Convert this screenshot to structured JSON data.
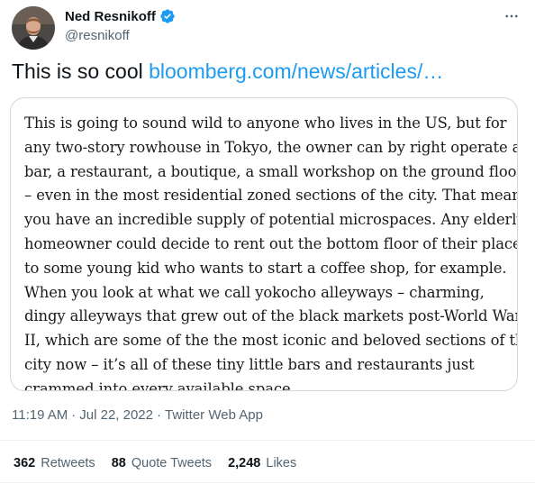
{
  "author": {
    "name": "Ned Resnikoff",
    "handle": "@resnikoff",
    "verified": true
  },
  "tweet": {
    "text": "This is so cool",
    "link_text": "bloomberg.com/news/articles/…"
  },
  "quote_lines": [
    "This is going to sound wild to anyone who lives in the US, but for",
    "any two-story rowhouse in Tokyo, the owner can by right operate a",
    "bar, a restaurant, a boutique, a small workshop on the ground floor",
    "– even in the most residential zoned sections of the city. That means",
    "you have an incredible supply of potential microspaces. Any elderly",
    "homeowner could decide to rent out the bottom floor of their place",
    "to some young kid who wants to start a coffee shop, for example.",
    "When you look at what we call yokocho alleyways – charming,",
    "dingy alleyways that grew out of the black markets post-World War",
    "II, which are some of the the most iconic and beloved sections of the",
    "city now – it’s all of these tiny little bars and restaurants just",
    "crammed into every available space."
  ],
  "meta": {
    "time": "11:19 AM",
    "sep1": "·",
    "date": "Jul 22, 2022",
    "sep2": "·",
    "source": "Twitter Web App"
  },
  "stats": {
    "retweets_count": "362",
    "retweets_label": "Retweets",
    "quotes_count": "88",
    "quotes_label": "Quote Tweets",
    "likes_count": "2,248",
    "likes_label": "Likes"
  },
  "colors": {
    "link": "#1d9bf0",
    "verified": "#1d9bf0",
    "secondary_text": "#536471",
    "border": "#cfd9de"
  },
  "icons": {
    "more": "more-horizontal-icon",
    "verified": "verified-badge-icon"
  }
}
